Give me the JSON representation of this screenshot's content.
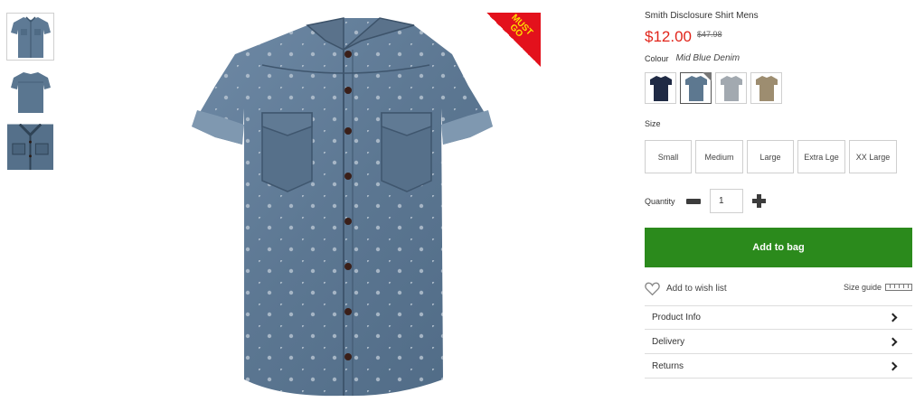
{
  "thumbnails": [
    {
      "name": "front-view",
      "active": true
    },
    {
      "name": "back-view",
      "active": false
    },
    {
      "name": "detail-view",
      "active": false
    }
  ],
  "badge": {
    "line1": "MUST",
    "line2": "GO",
    "color": "#e3111c",
    "text_color": "#ffde00"
  },
  "product": {
    "title": "Smith Disclosure Shirt Mens",
    "price": "$12.00",
    "was_price": "$47.98",
    "colour_label": "Colour",
    "colour_name": "Mid Blue Denim",
    "price_color": "#e1251b"
  },
  "swatches": [
    {
      "name": "navy",
      "color": "#1f2a44",
      "selected": false
    },
    {
      "name": "mid-blue-denim",
      "color": "#5d7890",
      "selected": true
    },
    {
      "name": "light-grey",
      "color": "#a2a9b0",
      "selected": false
    },
    {
      "name": "khaki",
      "color": "#9d8d70",
      "selected": false
    }
  ],
  "size": {
    "label": "Size",
    "options": [
      "Small",
      "Medium",
      "Large",
      "Extra Lge",
      "XX Large"
    ]
  },
  "quantity": {
    "label": "Quantity",
    "value": "1"
  },
  "actions": {
    "add_to_bag": "Add to bag",
    "add_to_bag_color": "#2b8a1c",
    "wish_list": "Add to wish list",
    "size_guide": "Size guide"
  },
  "accordion": [
    "Product Info",
    "Delivery",
    "Returns"
  ]
}
